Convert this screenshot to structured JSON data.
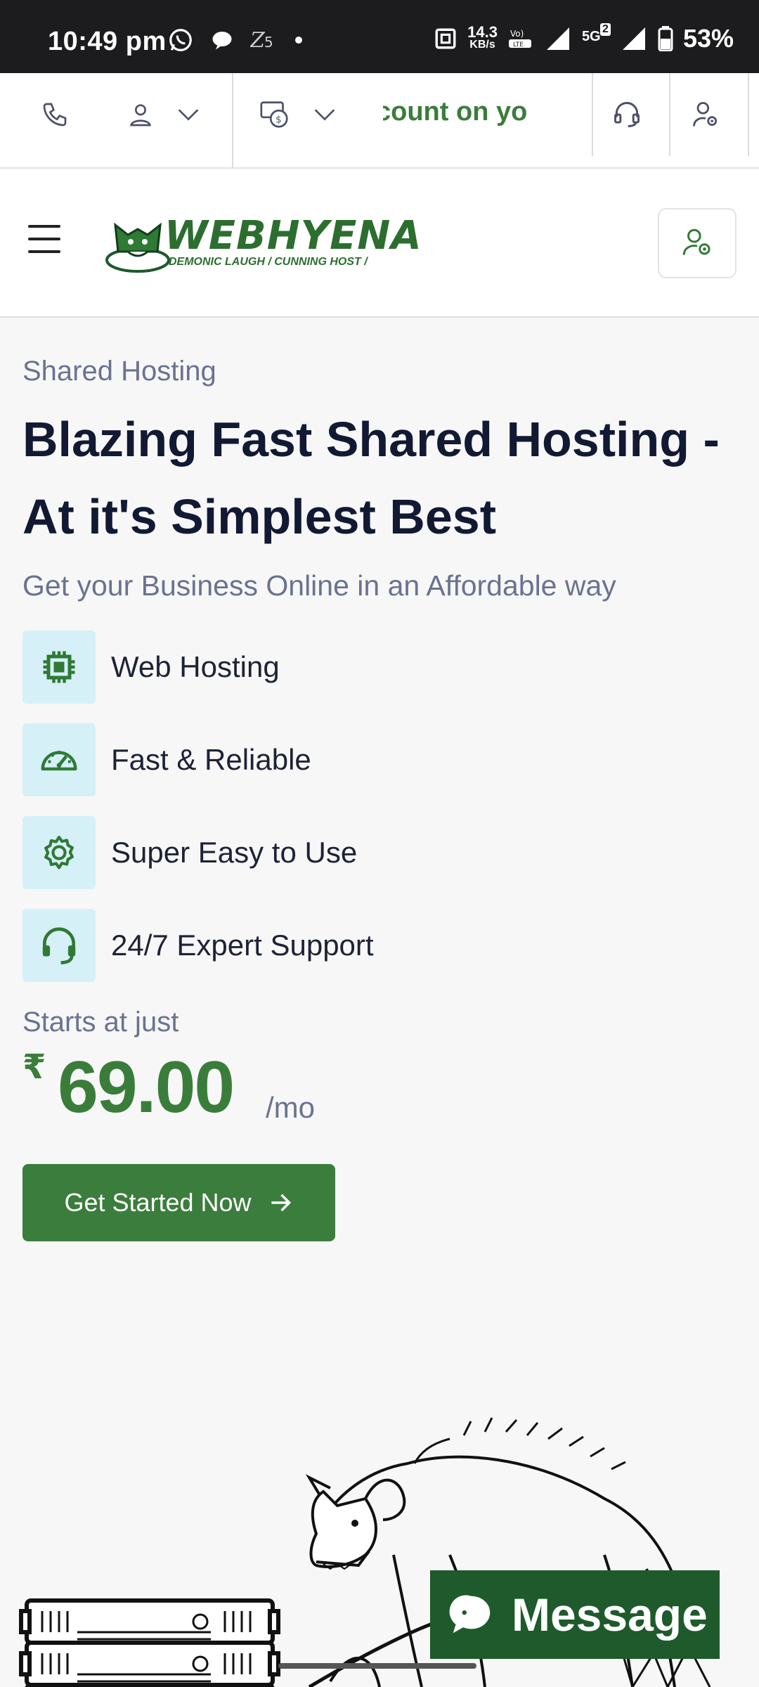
{
  "status_bar": {
    "time": "10:49 pm",
    "net_speed": "14.3",
    "net_unit": "KB/s",
    "network": "5G",
    "sim": "2",
    "battery": "53%"
  },
  "topbar": {
    "marquee_text": "count on yo"
  },
  "header": {
    "logo_name": "WEBHYENA",
    "logo_tagline": "DEMONIC LAUGH / CUNNING HOST /"
  },
  "hero": {
    "eyebrow": "Shared Hosting",
    "headline": "Blazing Fast Shared Hosting - At it's Simplest Best",
    "subline": "Get your Business Online in an Affordable way",
    "features": [
      {
        "label": "Web Hosting",
        "icon": "chip-icon"
      },
      {
        "label": "Fast & Reliable",
        "icon": "speedometer-icon"
      },
      {
        "label": "Super Easy to Use",
        "icon": "gear-icon"
      },
      {
        "label": "24/7 Expert Support",
        "icon": "headset-icon"
      }
    ],
    "starts_at": "Starts at just",
    "currency": "₹",
    "price": "69.00",
    "period": "/mo",
    "cta_label": "Get Started Now"
  },
  "chat": {
    "label": "Message"
  },
  "colors": {
    "brand_green": "#3b7d3c",
    "dark_navy": "#121933",
    "muted": "#6b7290",
    "icon_bg": "#d6f0f7"
  }
}
